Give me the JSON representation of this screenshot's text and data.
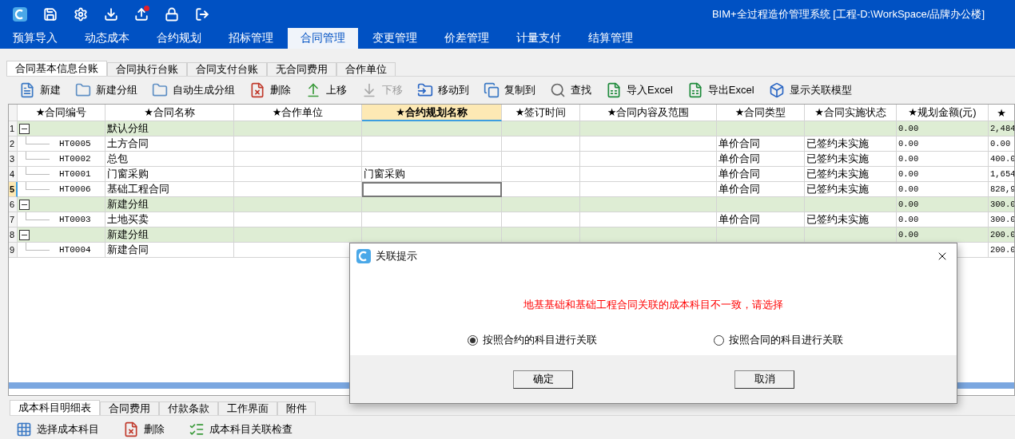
{
  "window": {
    "title": "BIM+全过程造价管理系统 [工程-D:\\WorkSpace/品牌办公楼]"
  },
  "menu_tabs": [
    {
      "label": "预算导入",
      "selected": false
    },
    {
      "label": "动态成本",
      "selected": false
    },
    {
      "label": "合约规划",
      "selected": false
    },
    {
      "label": "招标管理",
      "selected": false
    },
    {
      "label": "合同管理",
      "selected": true
    },
    {
      "label": "变更管理",
      "selected": false
    },
    {
      "label": "价差管理",
      "selected": false
    },
    {
      "label": "计量支付",
      "selected": false
    },
    {
      "label": "结算管理",
      "selected": false
    }
  ],
  "sub_tabs": [
    {
      "label": "合同基本信息台账",
      "selected": true
    },
    {
      "label": "合同执行台账",
      "selected": false
    },
    {
      "label": "合同支付台账",
      "selected": false
    },
    {
      "label": "无合同费用",
      "selected": false
    },
    {
      "label": "合作单位",
      "selected": false
    }
  ],
  "toolbar": [
    {
      "label": "新建",
      "disabled": false
    },
    {
      "label": "新建分组",
      "disabled": false
    },
    {
      "label": "自动生成分组",
      "disabled": false
    },
    {
      "label": "删除",
      "disabled": false
    },
    {
      "label": "上移",
      "disabled": false
    },
    {
      "label": "下移",
      "disabled": true
    },
    {
      "label": "移动到",
      "disabled": false
    },
    {
      "label": "复制到",
      "disabled": false
    },
    {
      "label": "查找",
      "disabled": false
    },
    {
      "label": "导入Excel",
      "disabled": false
    },
    {
      "label": "导出Excel",
      "disabled": false
    },
    {
      "label": "显示关联模型",
      "disabled": false
    }
  ],
  "table": {
    "columns": [
      {
        "label": "★合同编号",
        "selected": false
      },
      {
        "label": "★合同名称",
        "selected": false
      },
      {
        "label": "★合作单位",
        "selected": false
      },
      {
        "label": "★合约规划名称",
        "selected": true
      },
      {
        "label": "★签订时间",
        "selected": false
      },
      {
        "label": "★合同内容及范围",
        "selected": false
      },
      {
        "label": "★合同类型",
        "selected": false
      },
      {
        "label": "★合同实施状态",
        "selected": false
      },
      {
        "label": "★规划金额(元)",
        "selected": false
      },
      {
        "label": "★",
        "selected": false
      }
    ],
    "rows": [
      {
        "number": "1",
        "kind": "group",
        "expanded": true,
        "selected": false,
        "name": "默认分组",
        "amount": "0.00",
        "column_10": "2,484"
      },
      {
        "number": "2",
        "kind": "item",
        "selected": false,
        "code": "HT0005",
        "name": "土方合同",
        "type": "单价合同",
        "status": "已签约未实施",
        "amount": "0.00",
        "column_10": "0.00"
      },
      {
        "number": "3",
        "kind": "item",
        "selected": false,
        "code": "HT0002",
        "name": "总包",
        "type": "单价合同",
        "status": "已签约未实施",
        "amount": "0.00",
        "column_10": "400.0"
      },
      {
        "number": "4",
        "kind": "item",
        "selected": false,
        "code": "HT0001",
        "name": "门窗采购",
        "plan": "门窗采购",
        "type": "单价合同",
        "status": "已签约未实施",
        "amount": "0.00",
        "column_10": "1,654"
      },
      {
        "number": "5",
        "kind": "item",
        "selected": true,
        "code": "HT0006",
        "name": "基础工程合同",
        "type": "单价合同",
        "status": "已签约未实施",
        "amount": "0.00",
        "column_10": "828,9"
      },
      {
        "number": "6",
        "kind": "group",
        "expanded": true,
        "selected": false,
        "name": "新建分组",
        "amount": "0.00",
        "column_10": "300.0"
      },
      {
        "number": "7",
        "kind": "item",
        "selected": false,
        "code": "HT0003",
        "name": "土地买卖",
        "type": "单价合同",
        "status": "已签约未实施",
        "amount": "0.00",
        "column_10": "300.0"
      },
      {
        "number": "8",
        "kind": "group",
        "expanded": true,
        "selected": false,
        "name": "新建分组",
        "amount": "0.00",
        "column_10": "200.0"
      },
      {
        "number": "9",
        "kind": "item",
        "selected": false,
        "code": "HT0004",
        "name": "新建合同",
        "column_10": "200.0"
      }
    ]
  },
  "dialog": {
    "title": "关联提示",
    "message": "地基基础和基础工程合同关联的成本科目不一致，请选择",
    "options": [
      {
        "label": "按照合约的科目进行关联",
        "selected": true
      },
      {
        "label": "按照合同的科目进行关联",
        "selected": false
      }
    ],
    "buttons": [
      "确定",
      "取消"
    ]
  },
  "bottom_tabs": [
    {
      "label": "成本科目明细表",
      "selected": true
    },
    {
      "label": "合同费用",
      "selected": false
    },
    {
      "label": "付款条款",
      "selected": false
    },
    {
      "label": "工作界面",
      "selected": false
    },
    {
      "label": "附件",
      "selected": false
    }
  ],
  "bottom_toolbar": [
    {
      "label": "选择成本科目"
    },
    {
      "label": "删除"
    },
    {
      "label": "成本科目关联检查"
    }
  ]
}
